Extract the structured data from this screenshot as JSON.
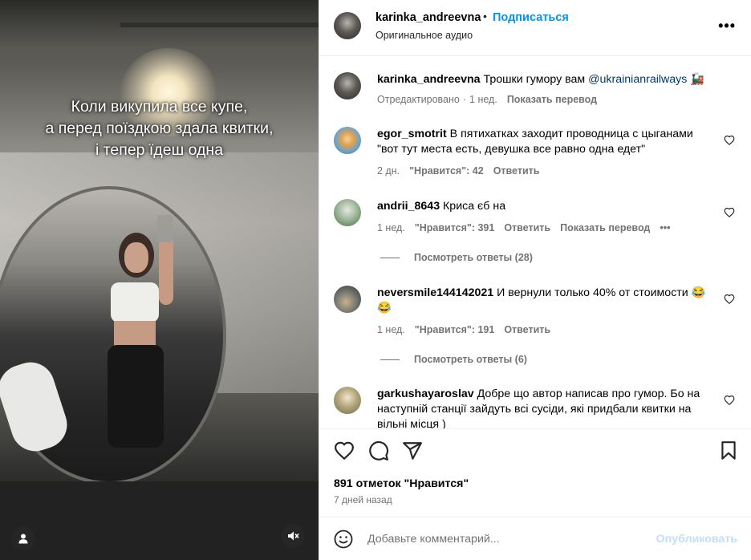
{
  "media": {
    "caption_lines": [
      "Коли викупила все купе,",
      "а перед поїздкою здала квитки,",
      "і тепер їдеш одна"
    ]
  },
  "header": {
    "username": "karinka_andreevna",
    "separator": "•",
    "follow_label": "Подписаться",
    "audio_label": "Оригинальное аудио",
    "more_label": "•••"
  },
  "post": {
    "username": "karinka_andreevna",
    "text": "Трошки гумору вам",
    "mention": "@ukrainianrailways",
    "emoji": "🚂",
    "edited": "Отредактировано",
    "dot": "·",
    "time": "1 нед.",
    "translate": "Показать перевод"
  },
  "comments": [
    {
      "username": "egor_smotrit",
      "text": "В пятихатках заходит проводница с цыганами \"вот тут места есть, девушка все равно одна едет\"",
      "time": "2 дн.",
      "likes": "\"Нравится\": 42",
      "reply": "Ответить",
      "avatar_color": "#6fa3c7"
    },
    {
      "username": "andrii_8643",
      "text": "Криса єб  на",
      "time": "1 нед.",
      "likes": "\"Нравится\": 391",
      "reply": "Ответить",
      "translate": "Показать перевод",
      "more": "•••",
      "view_replies": "Посмотреть ответы (28)",
      "avatar_color": "#8fa88a"
    },
    {
      "username": "neversmile144142021",
      "text": "И вернули только 40% от стоимости",
      "emoji": "😂😂",
      "time": "1 нед.",
      "likes": "\"Нравится\": 191",
      "reply": "Ответить",
      "view_replies": "Посмотреть ответы (6)",
      "avatar_color": "#6a6a6a"
    },
    {
      "username": "garkushayaroslav",
      "text": "Добре що автор написав про гумор. Бо на наступній станції зайдуть всі сусіди, які придбали квитки на вільні місця )",
      "avatar_color": "#b4a57a"
    }
  ],
  "actions": {
    "likes_count": "891 отметок \"Нравится\"",
    "date": "7 дней назад"
  },
  "add_comment": {
    "placeholder": "Добавьте комментарий...",
    "post_label": "Опубликовать"
  },
  "colors": {
    "accent": "#0095f6",
    "mention": "#00376b",
    "muted": "#737373",
    "post_disabled": "#c0dffd"
  }
}
